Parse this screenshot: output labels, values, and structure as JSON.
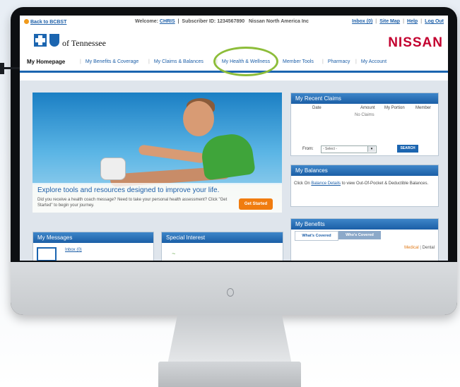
{
  "topbar": {
    "back_label": "Back to BCBST",
    "welcome_prefix": "Welcome:",
    "user_name": "CHRIS",
    "subscriber": "Subscriber ID: 1234567890",
    "company": "Nissan North America Inc",
    "links": [
      "Inbox (0)",
      "Site Map",
      "Help",
      "Log Out"
    ]
  },
  "logo": {
    "text": "of Tennessee"
  },
  "brand": "NISSAN",
  "nav": {
    "tabs": [
      "My Homepage",
      "My Benefits & Coverage",
      "My Claims & Balances",
      "My Health & Wellness",
      "Member Tools",
      "Pharmacy",
      "My Account"
    ]
  },
  "hero": {
    "title": "Explore tools and resources designed to improve your life.",
    "text": "Did you receive a health coach message? Need to take your personal health assessment? Click \"Get Started\" to begin your journey.",
    "cta": "Get Started"
  },
  "claims": {
    "title": "My Recent Claims",
    "columns": [
      "Date",
      "Amount",
      "My Portion",
      "Member"
    ],
    "empty": "No Claims",
    "from_label": "From:",
    "select_value": "- Select -",
    "search_label": "SEARCH"
  },
  "balances": {
    "title": "My Balances",
    "prefix": "Click On",
    "link": "Balance Details",
    "suffix": "to view Out-Of-Pocket & Deductible Balances."
  },
  "benefits": {
    "title": "My Benefits",
    "tabs": [
      "What's Covered",
      "Who's Covered"
    ],
    "medical": "Medical",
    "dental": "Dental"
  },
  "messages": {
    "title": "My Messages",
    "inbox": "Inbox (0)"
  },
  "special": {
    "title": "Special Interest"
  },
  "colors": {
    "accent": "#1b65b0",
    "brand": "#c3002f",
    "highlight": "#8dbd3a",
    "cta": "#f07c0f"
  }
}
